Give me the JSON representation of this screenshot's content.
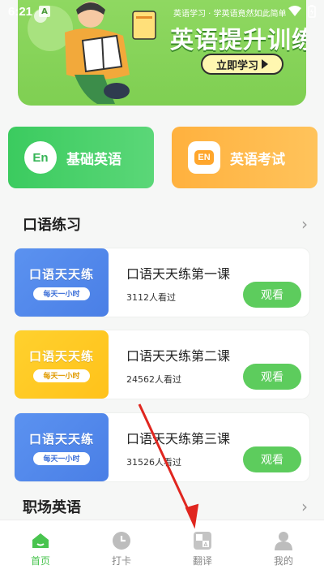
{
  "status_bar": {
    "time": "6:21",
    "badge": "A"
  },
  "banner": {
    "subtitle": "英语学习 · 学英语竟然如此简单",
    "title": "英语提升训练",
    "cta_label": "立即学习"
  },
  "categories": [
    {
      "icon_text": "En",
      "label": "基础英语"
    },
    {
      "icon_text": "EN",
      "label": "英语考试"
    }
  ],
  "sections": {
    "speaking": "口语练习",
    "workplace": "职场英语"
  },
  "lessons": [
    {
      "thumb_title": "口语天天练",
      "thumb_pill": "每天一小时",
      "title": "口语天天练第一课",
      "views": "3112人看过",
      "button": "观看"
    },
    {
      "thumb_title": "口语天天练",
      "thumb_pill": "每天一小时",
      "title": "口语天天练第二课",
      "views": "24562人看过",
      "button": "观看"
    },
    {
      "thumb_title": "口语天天练",
      "thumb_pill": "每天一小时",
      "title": "口语天天练第三课",
      "views": "31526人看过",
      "button": "观看"
    }
  ],
  "bottom_nav": [
    {
      "label": "首页",
      "icon": "home-icon",
      "active": true
    },
    {
      "label": "打卡",
      "icon": "clock-icon",
      "active": false
    },
    {
      "label": "翻译",
      "icon": "translate-icon",
      "active": false
    },
    {
      "label": "我的",
      "icon": "profile-icon",
      "active": false
    }
  ],
  "colors": {
    "brand_green": "#49c44f",
    "watch_green": "#5dcc5d",
    "banner_green": "#8fd861",
    "exam_orange": "#ffb13e",
    "thumb_blue": "#5b92f0",
    "thumb_yellow": "#ffd12e",
    "annotation_red": "#e0261f"
  }
}
